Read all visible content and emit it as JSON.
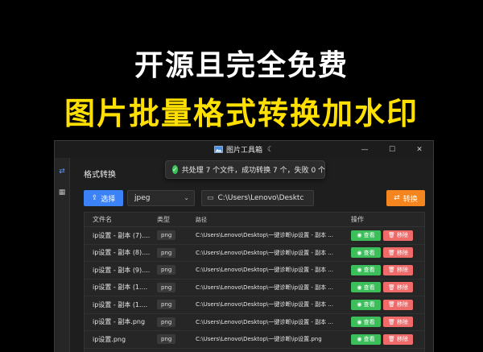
{
  "headline": {
    "line1": "开源且完全免费",
    "line2": "图片批量格式转换加水印"
  },
  "window": {
    "title": "图片工具箱",
    "theme_icon": "moon-icon",
    "minimize_glyph": "—",
    "maximize_glyph": "☐",
    "close_glyph": "✕"
  },
  "sidebar": {
    "items": [
      {
        "icon": "swap-icon",
        "glyph": "⇄"
      },
      {
        "icon": "watermark-icon",
        "glyph": "▦"
      }
    ]
  },
  "page": {
    "title": "格式转换"
  },
  "toast": {
    "message": "共处理 7 个文件，成功转换 7 个，失败 0 个"
  },
  "toolbar": {
    "select_label": "选择",
    "select_icon_glyph": "⇪",
    "format_value": "jpeg",
    "path_value": "C:\\Users\\Lenovo\\Desktc",
    "convert_label": "转换",
    "convert_icon_glyph": "⇄"
  },
  "table": {
    "headers": {
      "name": "文件名",
      "type": "类型",
      "path": "路径",
      "ops": "操作"
    },
    "view_label": "◉ 查看",
    "remove_label": "🗑 移除",
    "rows": [
      {
        "name": "ip设置 - 副本 (7)....",
        "type": "png",
        "path": "C:\\Users\\Lenovo\\Desktop\\一键诊断\\ip设置 - 副本 ..."
      },
      {
        "name": "ip设置 - 副本 (8)....",
        "type": "png",
        "path": "C:\\Users\\Lenovo\\Desktop\\一键诊断\\ip设置 - 副本 ..."
      },
      {
        "name": "ip设置 - 副本 (9)....",
        "type": "png",
        "path": "C:\\Users\\Lenovo\\Desktop\\一键诊断\\ip设置 - 副本 ..."
      },
      {
        "name": "ip设置 - 副本 (1....",
        "type": "png",
        "path": "C:\\Users\\Lenovo\\Desktop\\一键诊断\\ip设置 - 副本 ..."
      },
      {
        "name": "ip设置 - 副本 (1....",
        "type": "png",
        "path": "C:\\Users\\Lenovo\\Desktop\\一键诊断\\ip设置 - 副本 ..."
      },
      {
        "name": "ip设置 - 副本.png",
        "type": "png",
        "path": "C:\\Users\\Lenovo\\Desktop\\一键诊断\\ip设置 - 副本 ..."
      },
      {
        "name": "ip设置.png",
        "type": "png",
        "path": "C:\\Users\\Lenovo\\Desktop\\一键诊断\\ip设置.png"
      }
    ]
  }
}
